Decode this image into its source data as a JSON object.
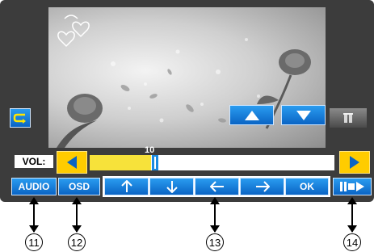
{
  "volume": {
    "label": "VOL:",
    "value": "10",
    "level_fraction": 0.25
  },
  "buttons": {
    "audio": "AUDIO",
    "osd": "OSD",
    "ok": "OK"
  },
  "callouts": [
    "11",
    "12",
    "13",
    "14"
  ],
  "icons": {
    "repeat": "repeat-icon",
    "up": "up-arrow-icon",
    "down": "down-arrow-icon",
    "left": "left-arrow-icon",
    "right": "right-arrow-icon",
    "play_pause": "play-pause-icon",
    "rewind": "rewind-icon",
    "forward": "forward-icon",
    "page_up": "triangle-up-icon",
    "page_down": "triangle-down-icon",
    "menu_toggle": "menu-toggle-icon"
  },
  "colors": {
    "accent_blue": "#1a8be0",
    "accent_yellow": "#ffcc00",
    "panel": "#3c3c3c"
  }
}
